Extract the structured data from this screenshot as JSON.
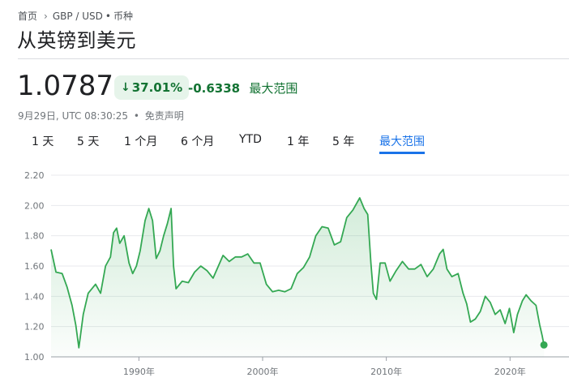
{
  "breadcrumb": {
    "home": "首页",
    "pair": "GBP / USD",
    "category": "币种"
  },
  "title": "从英镑到美元",
  "quote": {
    "price": "1.0787",
    "percent_change": "37.01%",
    "direction": "down",
    "abs_change": "-0.6338",
    "range_label": "最大范围"
  },
  "timestamp": {
    "text": "9月29日, UTC 08:30:25",
    "disclaimer": "免责声明"
  },
  "tabs": [
    {
      "label": "1 天",
      "active": false
    },
    {
      "label": "5 天",
      "active": false
    },
    {
      "label": "1 个月",
      "active": false
    },
    {
      "label": "6 个月",
      "active": false
    },
    {
      "label": "YTD",
      "active": false
    },
    {
      "label": "1 年",
      "active": false
    },
    {
      "label": "5 年",
      "active": false
    },
    {
      "label": "最大范围",
      "active": true
    }
  ],
  "colors": {
    "line": "#34a853",
    "positive": "#137333",
    "badge_bg": "#e6f4ea",
    "active_tab": "#1a73e8",
    "grid": "#e8eaed"
  },
  "chart_data": {
    "type": "area",
    "title": "",
    "xlabel": "",
    "ylabel": "",
    "ylim": [
      1.0,
      2.2
    ],
    "xlim": [
      1982.9,
      2022.8
    ],
    "yticks": [
      "1.00",
      "1.20",
      "1.40",
      "1.60",
      "1.80",
      "2.00",
      "2.20"
    ],
    "xticks": [
      {
        "value": 1990,
        "label": "1990年"
      },
      {
        "value": 2000,
        "label": "2000年"
      },
      {
        "value": 2010,
        "label": "2010年"
      },
      {
        "value": 2020,
        "label": "2020年"
      }
    ],
    "grid": true,
    "series": [
      {
        "points": [
          [
            1982.9,
            1.71
          ],
          [
            1983.3,
            1.56
          ],
          [
            1983.8,
            1.55
          ],
          [
            1984.2,
            1.46
          ],
          [
            1984.6,
            1.34
          ],
          [
            1984.9,
            1.21
          ],
          [
            1985.15,
            1.06
          ],
          [
            1985.5,
            1.28
          ],
          [
            1985.9,
            1.42
          ],
          [
            1986.5,
            1.48
          ],
          [
            1986.9,
            1.42
          ],
          [
            1987.3,
            1.6
          ],
          [
            1987.7,
            1.66
          ],
          [
            1987.95,
            1.82
          ],
          [
            1988.2,
            1.85
          ],
          [
            1988.45,
            1.75
          ],
          [
            1988.8,
            1.8
          ],
          [
            1989.2,
            1.62
          ],
          [
            1989.5,
            1.55
          ],
          [
            1989.8,
            1.6
          ],
          [
            1990.1,
            1.7
          ],
          [
            1990.5,
            1.9
          ],
          [
            1990.8,
            1.98
          ],
          [
            1991.1,
            1.9
          ],
          [
            1991.4,
            1.65
          ],
          [
            1991.7,
            1.7
          ],
          [
            1992.0,
            1.8
          ],
          [
            1992.3,
            1.88
          ],
          [
            1992.6,
            1.98
          ],
          [
            1992.8,
            1.6
          ],
          [
            1993.0,
            1.45
          ],
          [
            1993.5,
            1.5
          ],
          [
            1994.0,
            1.49
          ],
          [
            1994.5,
            1.56
          ],
          [
            1995.0,
            1.6
          ],
          [
            1995.5,
            1.57
          ],
          [
            1996.0,
            1.52
          ],
          [
            1996.8,
            1.67
          ],
          [
            1997.3,
            1.63
          ],
          [
            1997.8,
            1.66
          ],
          [
            1998.3,
            1.66
          ],
          [
            1998.8,
            1.68
          ],
          [
            1999.3,
            1.62
          ],
          [
            1999.8,
            1.62
          ],
          [
            2000.3,
            1.48
          ],
          [
            2000.8,
            1.43
          ],
          [
            2001.3,
            1.44
          ],
          [
            2001.8,
            1.43
          ],
          [
            2002.3,
            1.45
          ],
          [
            2002.8,
            1.55
          ],
          [
            2003.3,
            1.59
          ],
          [
            2003.8,
            1.66
          ],
          [
            2004.3,
            1.8
          ],
          [
            2004.8,
            1.86
          ],
          [
            2005.3,
            1.85
          ],
          [
            2005.8,
            1.74
          ],
          [
            2006.3,
            1.76
          ],
          [
            2006.8,
            1.92
          ],
          [
            2007.3,
            1.97
          ],
          [
            2007.85,
            2.05
          ],
          [
            2008.2,
            1.98
          ],
          [
            2008.5,
            1.94
          ],
          [
            2008.75,
            1.62
          ],
          [
            2008.95,
            1.42
          ],
          [
            2009.2,
            1.38
          ],
          [
            2009.5,
            1.62
          ],
          [
            2009.9,
            1.62
          ],
          [
            2010.3,
            1.5
          ],
          [
            2010.8,
            1.57
          ],
          [
            2011.3,
            1.63
          ],
          [
            2011.8,
            1.58
          ],
          [
            2012.3,
            1.58
          ],
          [
            2012.8,
            1.61
          ],
          [
            2013.3,
            1.53
          ],
          [
            2013.8,
            1.58
          ],
          [
            2014.3,
            1.68
          ],
          [
            2014.6,
            1.71
          ],
          [
            2014.9,
            1.58
          ],
          [
            2015.3,
            1.53
          ],
          [
            2015.8,
            1.55
          ],
          [
            2016.2,
            1.42
          ],
          [
            2016.5,
            1.35
          ],
          [
            2016.8,
            1.23
          ],
          [
            2017.2,
            1.25
          ],
          [
            2017.6,
            1.3
          ],
          [
            2018.0,
            1.4
          ],
          [
            2018.4,
            1.36
          ],
          [
            2018.8,
            1.28
          ],
          [
            2019.2,
            1.31
          ],
          [
            2019.6,
            1.22
          ],
          [
            2019.95,
            1.32
          ],
          [
            2020.3,
            1.16
          ],
          [
            2020.6,
            1.28
          ],
          [
            2021.0,
            1.37
          ],
          [
            2021.3,
            1.41
          ],
          [
            2021.7,
            1.37
          ],
          [
            2022.1,
            1.34
          ],
          [
            2022.4,
            1.21
          ],
          [
            2022.6,
            1.14
          ],
          [
            2022.74,
            1.0787
          ]
        ]
      }
    ]
  }
}
